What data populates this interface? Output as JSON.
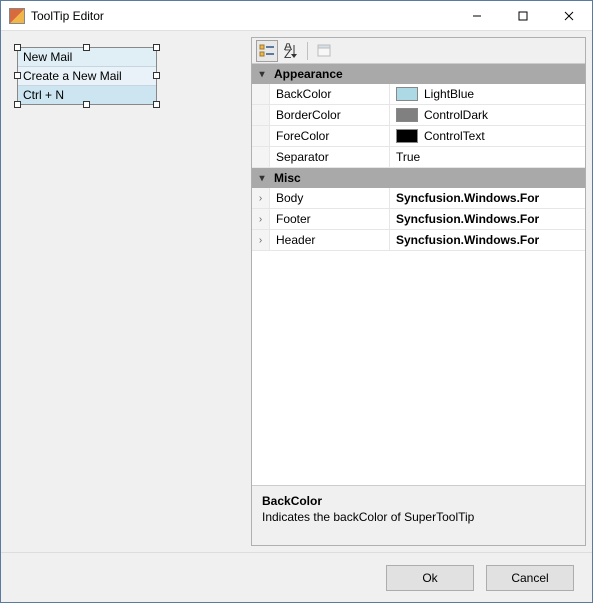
{
  "window": {
    "title": "ToolTip Editor"
  },
  "preview": {
    "header": "New Mail",
    "body": "Create a New Mail",
    "footer": "Ctrl + N"
  },
  "toolbar": {
    "categorized_tip": "Categorized",
    "alpha_tip": "Alphabetical",
    "pages_tip": "Property Pages"
  },
  "grid": {
    "cat_appearance": "Appearance",
    "cat_misc": "Misc",
    "appearance": [
      {
        "name": "BackColor",
        "value": "LightBlue",
        "swatch": "#ADD8E6",
        "selected": true
      },
      {
        "name": "BorderColor",
        "value": "ControlDark",
        "swatch": "#808080"
      },
      {
        "name": "ForeColor",
        "value": "ControlText",
        "swatch": "#000000"
      },
      {
        "name": "Separator",
        "value": "True"
      }
    ],
    "misc": [
      {
        "name": "Body",
        "value": "Syncfusion.Windows.For",
        "bold": true
      },
      {
        "name": "Footer",
        "value": "Syncfusion.Windows.For",
        "bold": true
      },
      {
        "name": "Header",
        "value": "Syncfusion.Windows.For",
        "bold": true
      }
    ]
  },
  "description": {
    "title": "BackColor",
    "text": "Indicates the backColor of SuperToolTip"
  },
  "buttons": {
    "ok": "Ok",
    "cancel": "Cancel"
  },
  "colors": {
    "lightblue": "#ADD8E6",
    "controldark": "#808080",
    "controltext": "#000000"
  }
}
